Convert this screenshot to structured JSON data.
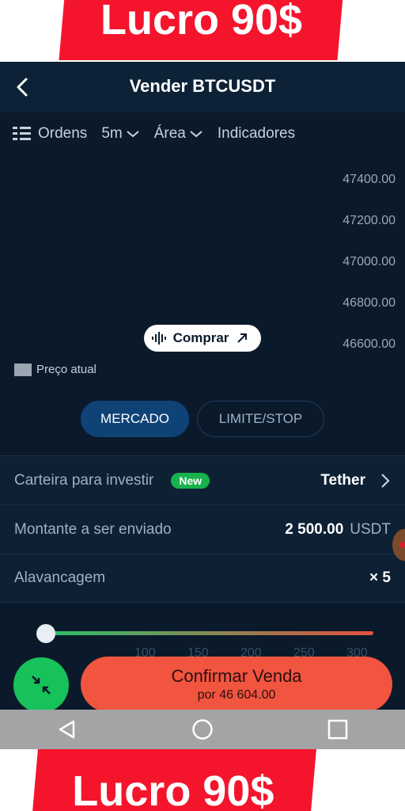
{
  "promo": {
    "top_text": "Lucro 90$",
    "bottom_text": "Lucro 90$",
    "color": "#f4152d"
  },
  "header": {
    "title": "Vender BTCUSDT"
  },
  "chart_toolbar": {
    "orders_label": "Ordens",
    "timeframe": "5m",
    "chart_type": "Área",
    "indicators_label": "Indicadores"
  },
  "chart": {
    "price_ticks": [
      "47400.00",
      "47200.00",
      "47000.00",
      "46800.00",
      "46600.00"
    ],
    "buy_button_label": "Comprar",
    "legend_label": "Preço atual"
  },
  "order_tabs": {
    "market": "MERCADO",
    "limit": "LIMITE/STOP",
    "active": "MERCADO"
  },
  "wallet": {
    "label": "Carteira para investir",
    "badge": "New",
    "value": "Tether"
  },
  "amount": {
    "label": "Montante a ser enviado",
    "value": "2 500.00",
    "unit": "USDT"
  },
  "leverage": {
    "label": "Alavancagem",
    "value": "× 5",
    "slider_ticks": [
      "100",
      "150",
      "200",
      "250",
      "300"
    ]
  },
  "confirm": {
    "label": "Confirmar Venda",
    "sub": "por 46 604.00",
    "color": "#f1543f"
  },
  "icons": {
    "back": "back-arrow-icon",
    "orders": "list-icon",
    "chevron": "chevron-down-icon",
    "buy": "sound-wave-icon",
    "arrow": "arrow-up-right-icon",
    "wallet_chevron": "chevron-right-icon",
    "expand": "collapse-arrows-icon",
    "nav_back": "triangle-back-icon",
    "nav_home": "circle-home-icon",
    "nav_recent": "square-recent-icon"
  }
}
